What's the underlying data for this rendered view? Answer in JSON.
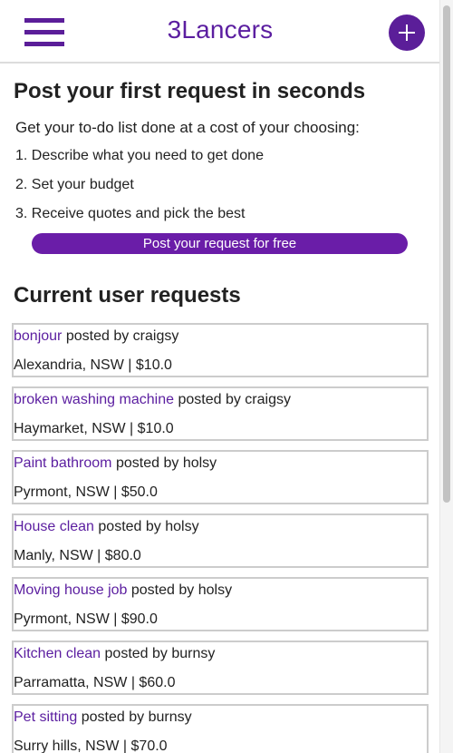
{
  "header": {
    "title": "3Lancers",
    "menu_icon": "hamburger-menu-icon",
    "add_icon": "plus-icon",
    "accent_color": "#5b1e99"
  },
  "intro": {
    "heading": "Post your first request in seconds",
    "lead": "Get your to-do list done at a cost of your choosing:",
    "steps": [
      "1. Describe what you need to get done",
      "2. Set your budget",
      "3. Receive quotes and pick the best"
    ],
    "cta_label": "Post your request for free"
  },
  "requests_section": {
    "heading": "Current user requests",
    "posted_by_label": "posted by",
    "items": [
      {
        "title": "bonjour",
        "user": "craigsy",
        "location": "Alexandria, NSW",
        "price": "$10.0"
      },
      {
        "title": "broken washing machine",
        "user": "craigsy",
        "location": "Haymarket, NSW",
        "price": "$10.0"
      },
      {
        "title": "Paint bathroom",
        "user": "holsy",
        "location": "Pyrmont, NSW",
        "price": "$50.0"
      },
      {
        "title": "House clean",
        "user": "holsy",
        "location": "Manly, NSW",
        "price": "$80.0"
      },
      {
        "title": "Moving house job",
        "user": "holsy",
        "location": "Pyrmont, NSW",
        "price": "$90.0"
      },
      {
        "title": "Kitchen clean",
        "user": "burnsy",
        "location": "Parramatta, NSW",
        "price": "$60.0"
      },
      {
        "title": "Pet sitting",
        "user": "burnsy",
        "location": "Surry hills, NSW",
        "price": "$70.0"
      }
    ]
  }
}
